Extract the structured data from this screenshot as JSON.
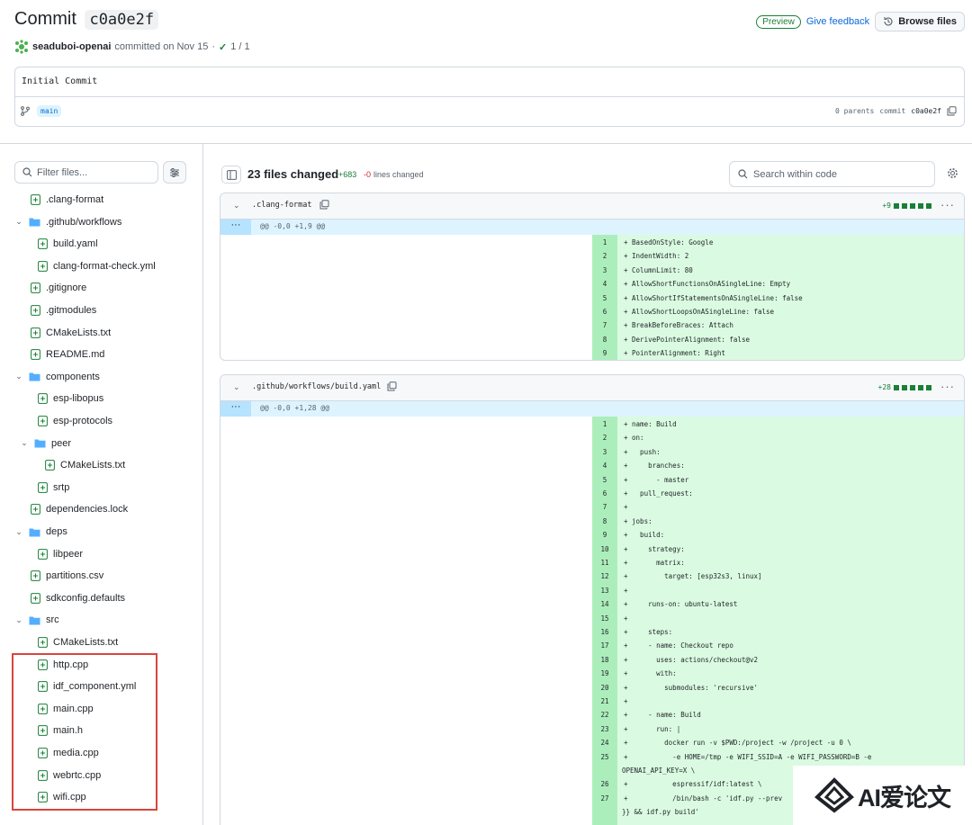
{
  "header": {
    "title_prefix": "Commit",
    "sha": "c0a0e2f",
    "author": "seaduboi-openai",
    "committed": "committed on Nov 15",
    "dot": "·",
    "checks": "1 / 1",
    "preview_label": "Preview",
    "feedback_label": "Give feedback",
    "browse_label": "Browse files"
  },
  "commit": {
    "message": "Initial Commit",
    "branch": "main",
    "parents": "0 parents",
    "commit_label": "commit",
    "sha": "c0a0e2f"
  },
  "sidebar": {
    "filter_placeholder": "Filter files...",
    "items": [
      {
        "label": ".clang-format",
        "kind": "file"
      },
      {
        "label": ".github/workflows",
        "kind": "folder"
      },
      {
        "label": "build.yaml",
        "kind": "file"
      },
      {
        "label": "clang-format-check.yml",
        "kind": "file"
      },
      {
        "label": ".gitignore",
        "kind": "file"
      },
      {
        "label": ".gitmodules",
        "kind": "file"
      },
      {
        "label": "CMakeLists.txt",
        "kind": "file"
      },
      {
        "label": "README.md",
        "kind": "file"
      },
      {
        "label": "components",
        "kind": "folder"
      },
      {
        "label": "esp-libopus",
        "kind": "file"
      },
      {
        "label": "esp-protocols",
        "kind": "file"
      },
      {
        "label": "peer",
        "kind": "folder"
      },
      {
        "label": "CMakeLists.txt",
        "kind": "file"
      },
      {
        "label": "srtp",
        "kind": "file"
      },
      {
        "label": "dependencies.lock",
        "kind": "file"
      },
      {
        "label": "deps",
        "kind": "folder"
      },
      {
        "label": "libpeer",
        "kind": "file"
      },
      {
        "label": "partitions.csv",
        "kind": "file"
      },
      {
        "label": "sdkconfig.defaults",
        "kind": "file"
      },
      {
        "label": "src",
        "kind": "folder"
      },
      {
        "label": "CMakeLists.txt",
        "kind": "file"
      },
      {
        "label": "http.cpp",
        "kind": "file"
      },
      {
        "label": "idf_component.yml",
        "kind": "file"
      },
      {
        "label": "main.cpp",
        "kind": "file"
      },
      {
        "label": "main.h",
        "kind": "file"
      },
      {
        "label": "media.cpp",
        "kind": "file"
      },
      {
        "label": "webrtc.cpp",
        "kind": "file"
      },
      {
        "label": "wifi.cpp",
        "kind": "file"
      }
    ]
  },
  "main": {
    "files_changed": "23 files changed",
    "additions": "+683",
    "deletions": "-0",
    "lines_changed": "lines changed",
    "search_placeholder": "Search within code",
    "files": [
      {
        "name": ".clang-format",
        "adds": "+9",
        "hunk": "@@ -0,0 +1,9 @@",
        "lines": [
          "+ BasedOnStyle: Google",
          "+ IndentWidth: 2",
          "+ ColumnLimit: 80",
          "+ AllowShortFunctionsOnASingleLine: Empty",
          "+ AllowShortIfStatementsOnASingleLine: false",
          "+ AllowShortLoopsOnASingleLine: false",
          "+ BreakBeforeBraces: Attach",
          "+ DerivePointerAlignment: false",
          "+ PointerAlignment: Right"
        ]
      },
      {
        "name": ".github/workflows/build.yaml",
        "adds": "+28",
        "hunk": "@@ -0,0 +1,28 @@",
        "lines": [
          "+ name: Build",
          "+ on:",
          "+   push:",
          "+     branches:",
          "+       - master",
          "+   pull_request:",
          "+",
          "+ jobs:",
          "+   build:",
          "+     strategy:",
          "+       matrix:",
          "+         target: [esp32s3, linux]",
          "+",
          "+     runs-on: ubuntu-latest",
          "+",
          "+     steps:",
          "+     - name: Checkout repo",
          "+       uses: actions/checkout@v2",
          "+       with:",
          "+         submodules: 'recursive'",
          "+",
          "+     - name: Build",
          "+       run: |",
          "+         docker run -v $PWD:/project -w /project -u 0 \\",
          "+           -e HOME=/tmp -e WIFI_SSID=A -e WIFI_PASSWORD=B -e",
          "+           espressif/idf:latest \\",
          "+           /bin/bash -c 'idf.py --prev"
        ],
        "wrap_line": "OPENAI_API_KEY=X \\",
        "wrap_line_2": "}} && idf.py build'"
      }
    ]
  },
  "watermark": "AI爱论文"
}
